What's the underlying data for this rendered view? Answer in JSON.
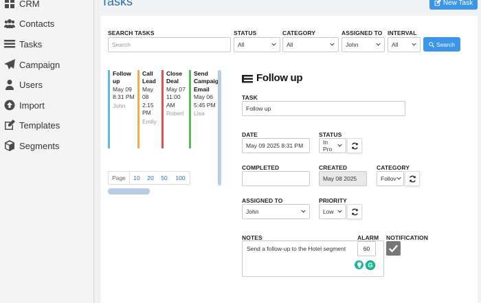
{
  "sidebar": {
    "items": [
      {
        "label": "CRM",
        "icon": "grid-icon"
      },
      {
        "label": "Contacts",
        "icon": "users-icon"
      },
      {
        "label": "Tasks",
        "icon": "tasks-icon"
      },
      {
        "label": "Campaign",
        "icon": "paper-plane-icon"
      },
      {
        "label": "Users",
        "icon": "user-icon"
      },
      {
        "label": "Import",
        "icon": "upload-circle-icon"
      },
      {
        "label": "Templates",
        "icon": "edit-icon"
      },
      {
        "label": "Segments",
        "icon": "cube-icon"
      }
    ]
  },
  "header": {
    "title": "Tasks",
    "new_task_label": "New Task"
  },
  "filters": {
    "search_label": "SEARCH TASKS",
    "search_placeholder": "Search",
    "status_label": "STATUS",
    "status_value": "All",
    "category_label": "CATEGORY",
    "category_value": "All",
    "assigned_label": "ASSIGNED TO",
    "assigned_value": "John",
    "interval_label": "INTERVAL",
    "interval_value": "All",
    "search_button": "Search"
  },
  "tasks": [
    {
      "title": "Follow up",
      "date": "May 09 8:31 PM",
      "assignee": "John",
      "color": "#5bc0de"
    },
    {
      "title": "Call Lead",
      "date": "May 08 2:15 PM",
      "assignee": "Emily",
      "color": "#f0ad4e"
    },
    {
      "title": "Close Deal",
      "date": "May 07 11:00 AM",
      "assignee": "Robert",
      "color": "#d9534f"
    },
    {
      "title": "Send Campaign Email",
      "date": "May 06 5:45 PM",
      "assignee": "Lisa",
      "color": "#5cb85c"
    }
  ],
  "pager": {
    "label": "Page",
    "sizes": [
      "10",
      "20",
      "50",
      "100"
    ]
  },
  "detail": {
    "title": "Follow up",
    "task_label": "TASK",
    "task_value": "Follow up",
    "date_label": "DATE",
    "date_value": "May 09 2025 8:31 PM",
    "status_label": "STATUS",
    "status_value": "In Pro",
    "completed_label": "COMPLETED",
    "completed_value": "",
    "created_label": "CREATED",
    "created_value": "May 08 2025",
    "category_label": "CATEGORY",
    "category_value": "Follov",
    "assigned_label": "ASSIGNED TO",
    "assigned_value": "John",
    "priority_label": "PRIORITY",
    "priority_value": "Low",
    "notes_label": "NOTES",
    "notes_value": "Send a follow-up to the Hotel segment",
    "alarm_label": "ALARM",
    "alarm_value": "60",
    "notification_label": "NOTIFICATION",
    "notification_checked": true
  },
  "colors": {
    "accent": "#3c95e6",
    "title_blue": "#2a6db0"
  }
}
